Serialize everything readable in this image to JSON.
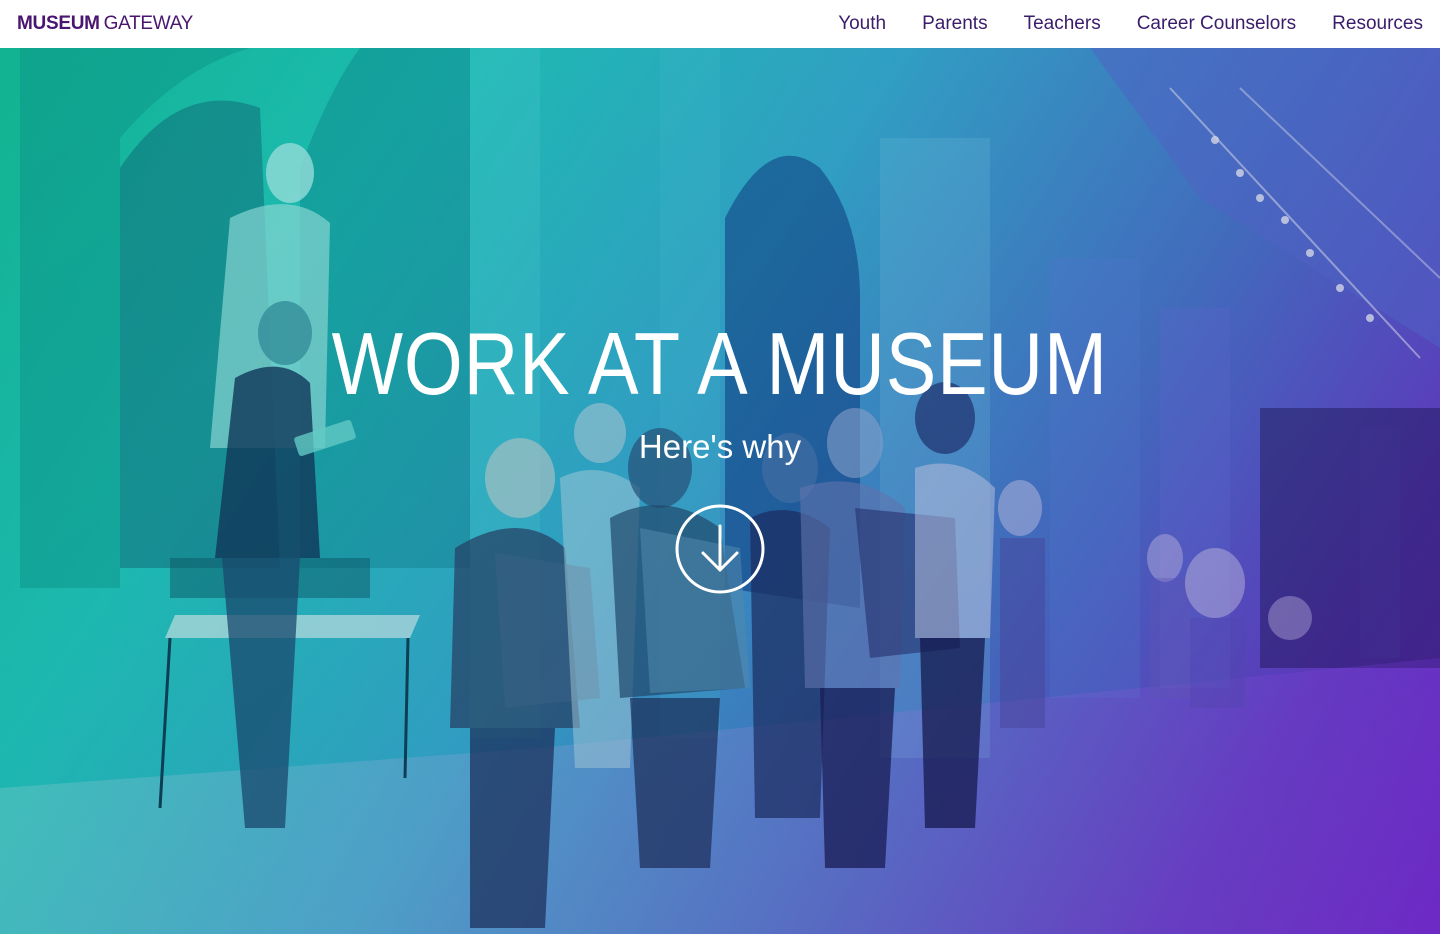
{
  "brand": {
    "name_bold": "MUSEUM",
    "name_light": "GATEWAY",
    "color": "#4a1570"
  },
  "nav": {
    "items": [
      {
        "label": "Youth"
      },
      {
        "label": "Parents"
      },
      {
        "label": "Teachers"
      },
      {
        "label": "Career Counselors"
      },
      {
        "label": "Resources"
      }
    ],
    "color": "#3a1c6b"
  },
  "hero": {
    "title": "WORK AT A MUSEUM",
    "subtitle": "Here's why",
    "scroll_icon": "arrow-down-circle-icon",
    "gradient": [
      "#13c59a",
      "#1fd1c0",
      "#36b3d6",
      "#4b77d0",
      "#6a3fd0",
      "#7b2bd8"
    ]
  }
}
